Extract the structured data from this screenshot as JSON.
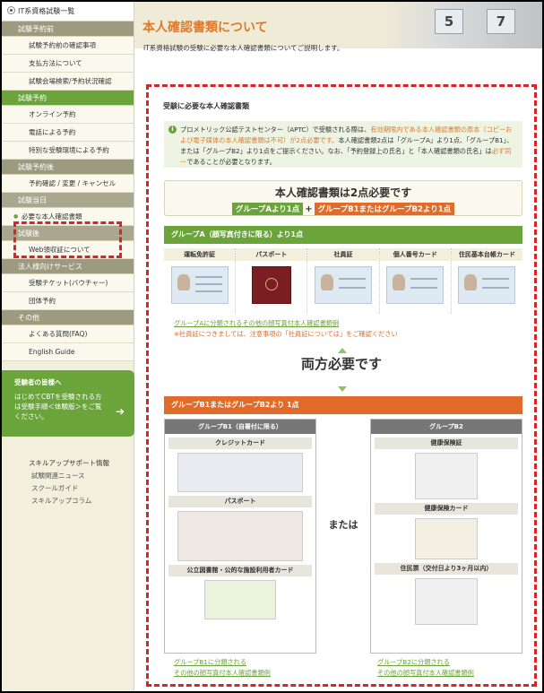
{
  "sidebar": {
    "root": "IT系資格試験一覧",
    "sections": [
      {
        "label": "試験予約前",
        "items": [
          "試験予約前の確認事項",
          "支払方法について",
          "試験会場検索/予約状況確認"
        ]
      },
      {
        "label": "試験予約",
        "items": [
          "オンライン予約",
          "電話による予約",
          "特別な受験環境による予約"
        ]
      },
      {
        "label": "試験予約後",
        "items": [
          "予約確認 / 変更 / キャンセル"
        ]
      },
      {
        "label": "試験当日",
        "items": [
          "必要な本人確認書類"
        ]
      },
      {
        "label": "試験後",
        "items": [
          "Web領収証について"
        ]
      },
      {
        "label": "法人様向けサービス",
        "items": [
          "受験チケット(バウチャー)",
          "団体予約"
        ]
      },
      {
        "label": "その他",
        "items": [
          "よくある質問(FAQ)",
          "English Guide"
        ]
      }
    ],
    "box": {
      "title": "受験者の皆様へ",
      "desc": "はじめてCBTを受験される方は受験手順＜体験版＞をご覧ください。"
    },
    "skill": {
      "heading": "スキルアップサポート情報",
      "links": [
        "試験関連ニュース",
        "スクールガイド",
        "スキルアップコラム"
      ]
    }
  },
  "main": {
    "title": "本人確認書類について",
    "intro": "IT系資格試験の受験に必要な本人確認書類についてご説明します。",
    "heading": "受験に必要な本人確認書類",
    "notice": {
      "p1": "プロメトリック公認テストセンター（APTC）で受験される際は、",
      "p2": "有効期限内である本人確認書類の原本（コピーおよび電子媒体の本人確認書類は不可）が2点必要です。",
      "p3": "本人確認書類2点は「グループA」より1点、「グループB1」、または「グループB2」より1点をご提示ください。",
      "p4": "なお、「予約登録上の氏名」と「本人確認書類の氏名」は",
      "p5": "必ず同一",
      "p6": "であることが必要となります。"
    },
    "banner": {
      "big": "本人確認書類は2点必要です",
      "ga": "グループAより1点",
      "plus": "+",
      "gb": "グループB1またはグループB2より1点"
    },
    "groupA": {
      "bar": "グループA（顔写真付きに限る）より1点",
      "cards": [
        "運転免許証",
        "パスポート",
        "社員証",
        "個人番号カード",
        "住民基本台帳カード"
      ],
      "link": "グループAに分類されるその他の顔写真付本人確認書類例",
      "note": "※社員証につきましては、注意事項の「社員証については」をご確認ください"
    },
    "both": "両方必要です",
    "groupB": {
      "bar": "グループB1またはグループB2より 1点",
      "b1": {
        "header": "グループB1（自署付に限る）",
        "subs": [
          "クレジットカード",
          "パスポート",
          "公立図書館・公的な施設利用者カード"
        ],
        "link1": "グループB1に分類される",
        "link2": "その他の顔写真付本人確認書類例"
      },
      "or": "または",
      "b2": {
        "header": "グループB2",
        "subs": [
          "健康保険証",
          "健康保険カード",
          "住民票（交付日より3ヶ月以内）"
        ],
        "link1": "グループB2に分類される",
        "link2": "その他の顔写真付本人確認書類例"
      }
    }
  }
}
